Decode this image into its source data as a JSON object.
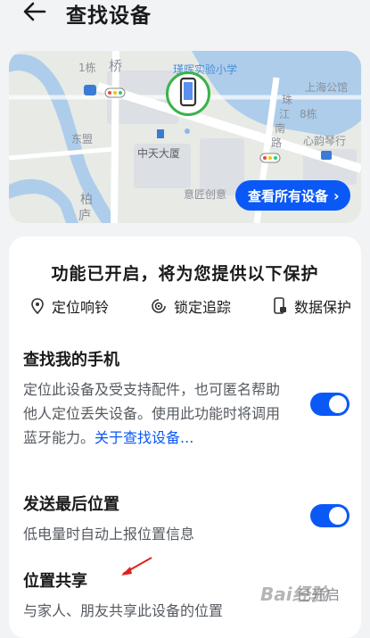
{
  "header": {
    "title": "查找设备"
  },
  "map": {
    "labels": {
      "l1": "1栋",
      "l2": "桥",
      "school": "瑾晖实验小学",
      "hotel": "上海公馆",
      "zhu": "珠",
      "jiang": "江",
      "nan": "南",
      "lu": "路",
      "b8": "8栋",
      "xinyu": "心韵琴行",
      "dongmeng": "东盟",
      "tower": "中天大厦",
      "yijiang": "意匠创意",
      "bo": "柏",
      "lu2": "庐"
    },
    "view_all_label": "查看所有设备"
  },
  "card": {
    "heading": "功能已开启，将为您提供以下保护",
    "features": [
      {
        "label": "定位响铃",
        "icon": "location-pin-icon"
      },
      {
        "label": "锁定追踪",
        "icon": "lock-track-icon"
      },
      {
        "label": "数据保护",
        "icon": "phone-lock-icon"
      }
    ],
    "find_phone": {
      "title": "查找我的手机",
      "desc": "定位此设备及受支持配件，也可匿名帮助他人定位丢失设备。使用此功能时将调用蓝牙能力。",
      "link": "关于查找设备...",
      "enabled": true
    },
    "last_location": {
      "title": "发送最后位置",
      "desc": "低电量时自动上报位置信息",
      "enabled": true
    },
    "location_share": {
      "title": "位置共享",
      "desc": "与家人、朋友共享此设备的位置",
      "status": "已开启"
    }
  },
  "colors": {
    "accent": "#0a59f7",
    "pin_ring": "#39b34a",
    "annotation_arrow": "#e02020"
  },
  "watermark": "Bai经验"
}
